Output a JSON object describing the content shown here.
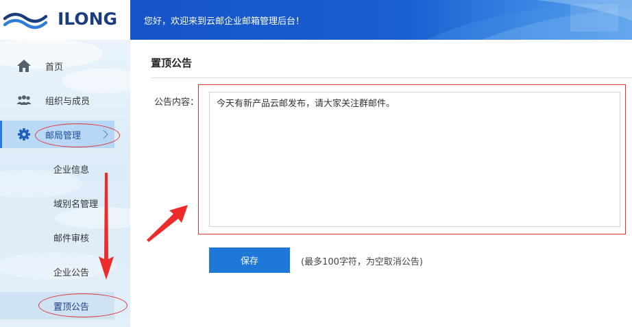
{
  "brand": {
    "name": "ILONG"
  },
  "header": {
    "welcome": "您好，欢迎来到云邮企业邮箱管理后台！"
  },
  "sidebar": {
    "items": [
      {
        "label": "首页",
        "icon": "home-icon"
      },
      {
        "label": "组织与成员",
        "icon": "users-icon"
      },
      {
        "label": "邮局管理",
        "icon": "gear-icon",
        "active": true
      }
    ],
    "subitems": [
      {
        "label": "企业信息"
      },
      {
        "label": "域别名管理"
      },
      {
        "label": "邮件审核"
      },
      {
        "label": "企业公告"
      },
      {
        "label": "置顶公告",
        "active": true
      }
    ]
  },
  "main": {
    "title": "置顶公告",
    "field_label": "公告内容：",
    "content_value": "今天有新产品云邮发布，请大家关注群邮件。",
    "save_label": "保存",
    "hint": "(最多100字符，为空取消公告)"
  },
  "colors": {
    "accent": "#1e78d8",
    "banner": "#1553c7",
    "annotation": "#e03232"
  }
}
